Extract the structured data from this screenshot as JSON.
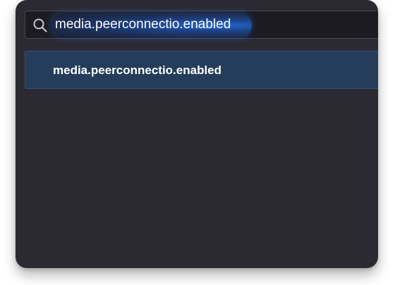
{
  "search": {
    "value": "media.peerconnectio.enabled",
    "icon": "search-icon"
  },
  "results": {
    "items": [
      {
        "name": "media.peerconnectio.enabled"
      }
    ]
  },
  "colors": {
    "background": "#2b2a33",
    "search_field": "#1c1b22",
    "selected_row": "#253d5b",
    "highlight": "#2a6fd6",
    "text": "#fbfbfe"
  }
}
